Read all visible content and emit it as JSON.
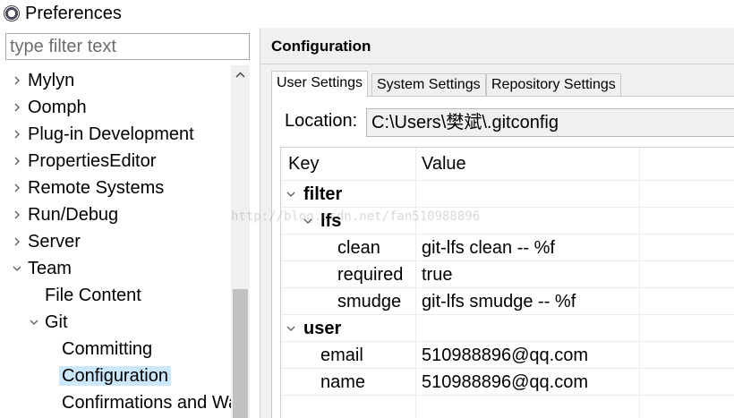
{
  "window": {
    "title": "Preferences",
    "icon": "eclipse-icon"
  },
  "left": {
    "filter_placeholder": "type filter text",
    "tree": [
      {
        "label": "Mylyn",
        "state": "collapsed"
      },
      {
        "label": "Oomph",
        "state": "collapsed"
      },
      {
        "label": "Plug-in Development",
        "state": "collapsed"
      },
      {
        "label": "PropertiesEditor",
        "state": "collapsed"
      },
      {
        "label": "Remote Systems",
        "state": "collapsed"
      },
      {
        "label": "Run/Debug",
        "state": "collapsed"
      },
      {
        "label": "Server",
        "state": "collapsed"
      },
      {
        "label": "Team",
        "state": "expanded"
      },
      {
        "label": "File Content",
        "state": "leaf"
      },
      {
        "label": "Git",
        "state": "expanded"
      },
      {
        "label": "Committing",
        "state": "leaf"
      },
      {
        "label": "Configuration",
        "state": "selected"
      },
      {
        "label": "Confirmations and Warnings",
        "state": "leaf"
      }
    ]
  },
  "right": {
    "page_title": "Configuration",
    "tabs": [
      {
        "label": "User Settings",
        "active": true
      },
      {
        "label": "System Settings",
        "active": false
      },
      {
        "label": "Repository Settings",
        "active": false
      }
    ],
    "location_label": "Location:",
    "location_value": "C:\\Users\\樊斌\\.gitconfig",
    "table": {
      "headers": {
        "key": "Key",
        "value": "Value"
      },
      "rows": [
        {
          "key": "filter",
          "value": "",
          "level": 0,
          "group": true
        },
        {
          "key": "lfs",
          "value": "",
          "level": 1,
          "group": true
        },
        {
          "key": "clean",
          "value": "git-lfs clean -- %f",
          "level": 2,
          "group": false
        },
        {
          "key": "required",
          "value": "true",
          "level": 2,
          "group": false
        },
        {
          "key": "smudge",
          "value": "git-lfs smudge -- %f",
          "level": 2,
          "group": false
        },
        {
          "key": "user",
          "value": "",
          "level": 0,
          "group": true
        },
        {
          "key": "email",
          "value": "510988896@qq.com",
          "level": 1,
          "group": false
        },
        {
          "key": "name",
          "value": "510988896@qq.com",
          "level": 1,
          "group": false
        }
      ]
    }
  },
  "watermark": "http://blog.csdn.net/fan510988896",
  "colors": {
    "selection": "#cce8ff",
    "panel_bg": "#f0f0f0",
    "border": "#c8c8c8"
  }
}
